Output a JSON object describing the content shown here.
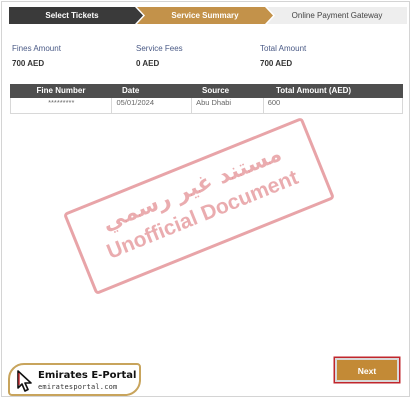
{
  "stepper": {
    "steps": [
      {
        "label": "Select Tickets",
        "state": "done"
      },
      {
        "label": "Service Summary",
        "state": "active"
      },
      {
        "label": "Online Payment Gateway",
        "state": "pending"
      }
    ]
  },
  "summary": {
    "fines_amount_label": "Fines Amount",
    "fines_amount_value": "700  AED",
    "service_fees_label": "Service Fees",
    "service_fees_value": "0  AED",
    "total_amount_label": "Total Amount",
    "total_amount_value": "700  AED"
  },
  "table": {
    "headers": [
      "Fine Number",
      "Date",
      "Source",
      "Total Amount (AED)"
    ],
    "rows": [
      [
        "*********",
        "05/01/2024",
        "Abu Dhabi",
        "600"
      ]
    ]
  },
  "stamp": {
    "arabic": "مستند غير رسمي",
    "english": "Unofficial Document"
  },
  "logo": {
    "title": "Emirates E-Portal",
    "url": "emiratesportal.com"
  },
  "actions": {
    "next_label": "Next"
  },
  "colors": {
    "step_done": "#3a3a3a",
    "step_active": "#c3924a",
    "step_pending": "#eeeeee",
    "table_header": "#4e4e4e",
    "button": "#c38a36",
    "stamp": "#d65a60"
  }
}
